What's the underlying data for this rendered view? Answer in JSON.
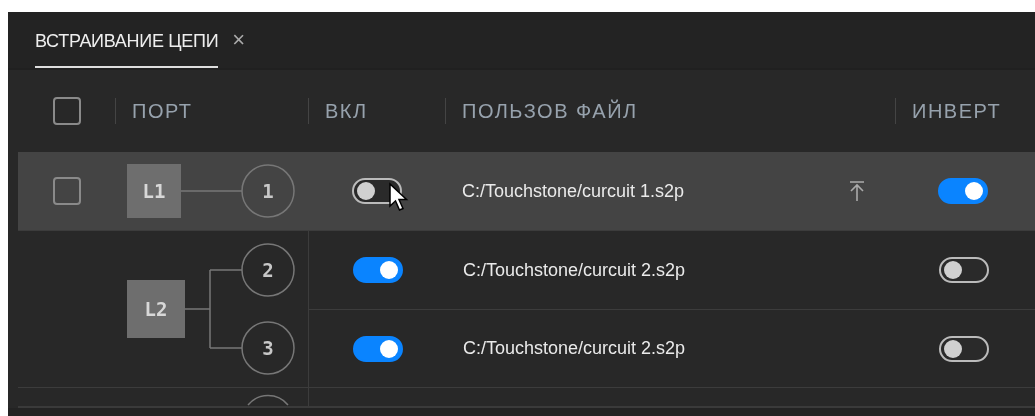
{
  "tab": {
    "title": "ВСТРАИВАНИЕ ЦЕПИ",
    "close": "×",
    "selected": true
  },
  "columns": [
    {
      "label": "ПОРТ"
    },
    {
      "label": "ВКЛ"
    },
    {
      "label": "ПОЛЬЗОВ ФАЙЛ"
    },
    {
      "label": "ИНВЕРТ"
    }
  ],
  "header_checkbox": {
    "checked": false
  },
  "groups": [
    {
      "label": "L1",
      "hovered": true,
      "checkbox": {
        "checked": false
      },
      "ports": [
        {
          "number": "1",
          "on": false,
          "file": "C:/Touchstone/curcuit 1.s2p",
          "upload": true,
          "invert": true
        }
      ]
    },
    {
      "label": "L2",
      "hovered": false,
      "ports": [
        {
          "number": "2",
          "on": true,
          "file": "C:/Touchstone/curcuit 2.s2p",
          "upload": false,
          "invert": false
        },
        {
          "number": "3",
          "on": true,
          "file": "C:/Touchstone/curcuit 2.s2p",
          "upload": false,
          "invert": false
        }
      ]
    }
  ]
}
